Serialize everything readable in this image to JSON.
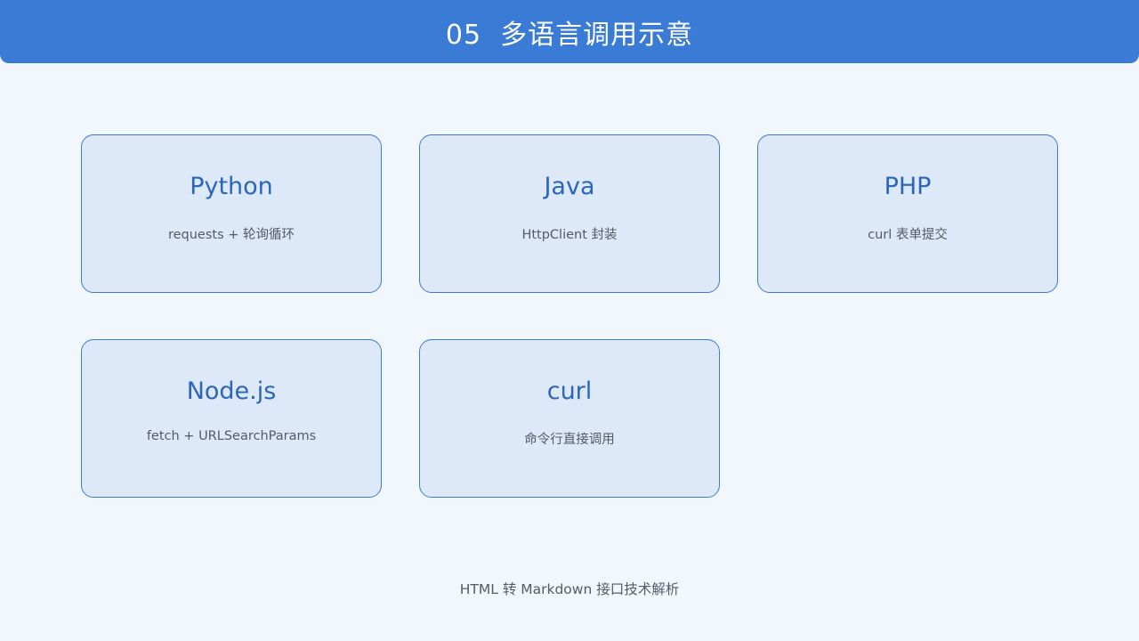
{
  "header": {
    "title": "05  多语言调用示意"
  },
  "cards": [
    {
      "title": "Python",
      "desc": "requests + 轮询循环"
    },
    {
      "title": "Java",
      "desc": "HttpClient 封装"
    },
    {
      "title": "PHP",
      "desc": "curl 表单提交"
    },
    {
      "title": "Node.js",
      "desc": "fetch + URLSearchParams"
    },
    {
      "title": "curl",
      "desc": "命令行直接调用"
    }
  ],
  "footer": {
    "text": "HTML 转 Markdown 接口技术解析"
  },
  "colors": {
    "header_background": "#3a7bd5",
    "card_border": "#3a7bd5",
    "card_background": "#dde9f8",
    "card_title": "#2b66b8",
    "page_background": "#f2f7fd"
  }
}
